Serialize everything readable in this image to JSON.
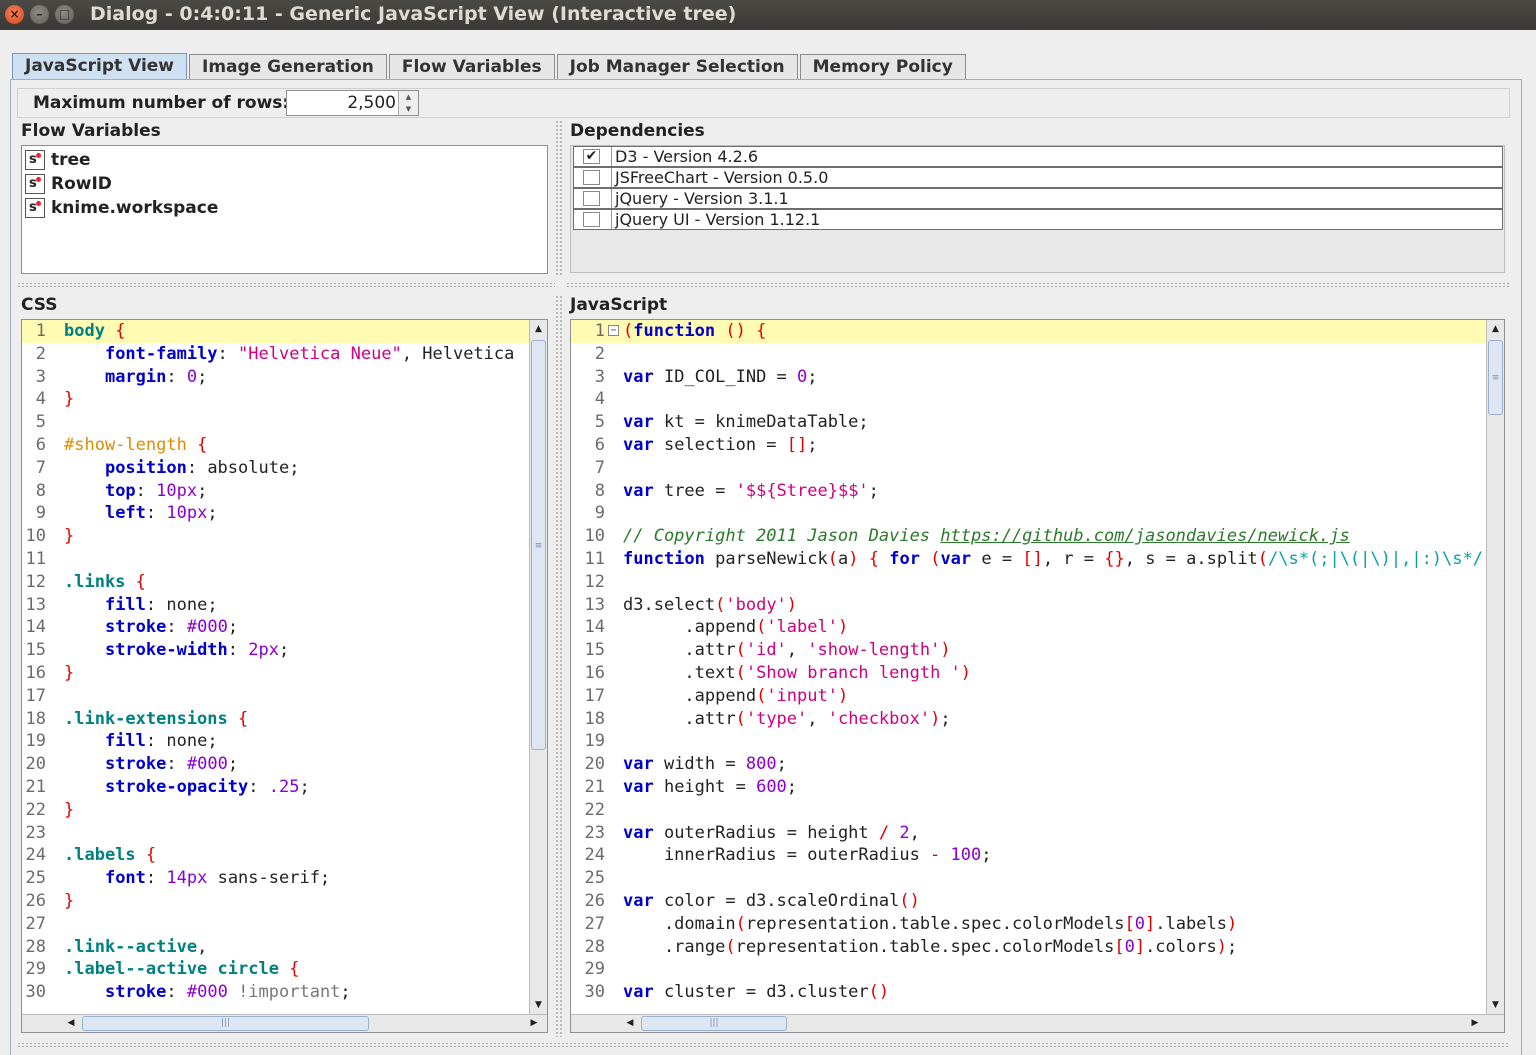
{
  "window": {
    "title": "Dialog - 0:4:0:11 - Generic JavaScript View (Interactive tree)"
  },
  "tabs": [
    "JavaScript View",
    "Image Generation",
    "Flow Variables",
    "Job Manager Selection",
    "Memory Policy"
  ],
  "options": {
    "max_rows_label": "Maximum number of rows:",
    "max_rows_value": "2,500"
  },
  "flow_variables": {
    "title": "Flow Variables",
    "items": [
      "tree",
      "RowID",
      "knime.workspace"
    ],
    "type_badge": "s"
  },
  "dependencies": {
    "title": "Dependencies",
    "items": [
      {
        "label": "D3 - Version 4.2.6",
        "checked": true
      },
      {
        "label": "JSFreeChart - Version 0.5.0",
        "checked": false
      },
      {
        "label": "jQuery - Version 3.1.1",
        "checked": false
      },
      {
        "label": "jQuery UI - Version 1.12.1",
        "checked": false
      }
    ]
  },
  "css_editor": {
    "title": "CSS",
    "lines": [
      [
        [
          "cls",
          "body"
        ],
        [
          "t",
          " "
        ],
        [
          "pn",
          "{"
        ]
      ],
      [
        [
          "t",
          "    "
        ],
        [
          "kw",
          "font-family"
        ],
        [
          "t",
          ": "
        ],
        [
          "str",
          "\"Helvetica Neue\""
        ],
        [
          "t",
          ", Helvetica"
        ]
      ],
      [
        [
          "t",
          "    "
        ],
        [
          "kw",
          "margin"
        ],
        [
          "t",
          ": "
        ],
        [
          "num",
          "0"
        ],
        [
          "t",
          ";"
        ]
      ],
      [
        [
          "pn",
          "}"
        ]
      ],
      [],
      [
        [
          "id",
          "#show-length"
        ],
        [
          "t",
          " "
        ],
        [
          "pn",
          "{"
        ]
      ],
      [
        [
          "t",
          "    "
        ],
        [
          "kw",
          "position"
        ],
        [
          "t",
          ": absolute;"
        ]
      ],
      [
        [
          "t",
          "    "
        ],
        [
          "kw",
          "top"
        ],
        [
          "t",
          ": "
        ],
        [
          "num",
          "10px"
        ],
        [
          "t",
          ";"
        ]
      ],
      [
        [
          "t",
          "    "
        ],
        [
          "kw",
          "left"
        ],
        [
          "t",
          ": "
        ],
        [
          "num",
          "10px"
        ],
        [
          "t",
          ";"
        ]
      ],
      [
        [
          "pn",
          "}"
        ]
      ],
      [],
      [
        [
          "cls",
          ".links"
        ],
        [
          "t",
          " "
        ],
        [
          "pn",
          "{"
        ]
      ],
      [
        [
          "t",
          "    "
        ],
        [
          "kw",
          "fill"
        ],
        [
          "t",
          ": none;"
        ]
      ],
      [
        [
          "t",
          "    "
        ],
        [
          "kw",
          "stroke"
        ],
        [
          "t",
          ": "
        ],
        [
          "num",
          "#000"
        ],
        [
          "t",
          ";"
        ]
      ],
      [
        [
          "t",
          "    "
        ],
        [
          "kw",
          "stroke-width"
        ],
        [
          "t",
          ": "
        ],
        [
          "num",
          "2px"
        ],
        [
          "t",
          ";"
        ]
      ],
      [
        [
          "pn",
          "}"
        ]
      ],
      [],
      [
        [
          "cls",
          ".link-extensions"
        ],
        [
          "t",
          " "
        ],
        [
          "pn",
          "{"
        ]
      ],
      [
        [
          "t",
          "    "
        ],
        [
          "kw",
          "fill"
        ],
        [
          "t",
          ": none;"
        ]
      ],
      [
        [
          "t",
          "    "
        ],
        [
          "kw",
          "stroke"
        ],
        [
          "t",
          ": "
        ],
        [
          "num",
          "#000"
        ],
        [
          "t",
          ";"
        ]
      ],
      [
        [
          "t",
          "    "
        ],
        [
          "kw",
          "stroke-opacity"
        ],
        [
          "t",
          ": "
        ],
        [
          "num",
          ".25"
        ],
        [
          "t",
          ";"
        ]
      ],
      [
        [
          "pn",
          "}"
        ]
      ],
      [],
      [
        [
          "cls",
          ".labels"
        ],
        [
          "t",
          " "
        ],
        [
          "pn",
          "{"
        ]
      ],
      [
        [
          "t",
          "    "
        ],
        [
          "kw",
          "font"
        ],
        [
          "t",
          ": "
        ],
        [
          "num",
          "14px"
        ],
        [
          "t",
          " sans-serif;"
        ]
      ],
      [
        [
          "pn",
          "}"
        ]
      ],
      [],
      [
        [
          "cls",
          ".link--active"
        ],
        [
          "t",
          ","
        ]
      ],
      [
        [
          "cls",
          ".label--active circle"
        ],
        [
          "t",
          " "
        ],
        [
          "pn",
          "{"
        ]
      ],
      [
        [
          "t",
          "    "
        ],
        [
          "kw",
          "stroke"
        ],
        [
          "t",
          ": "
        ],
        [
          "num",
          "#000"
        ],
        [
          "t",
          " "
        ],
        [
          "imp",
          "!important"
        ],
        [
          "t",
          ";"
        ]
      ]
    ]
  },
  "js_editor": {
    "title": "JavaScript",
    "lines": [
      [
        [
          "pn",
          "("
        ],
        [
          "kw",
          "function"
        ],
        [
          "t",
          " "
        ],
        [
          "pn",
          "()"
        ],
        [
          "t",
          " "
        ],
        [
          "pn",
          "{"
        ]
      ],
      [],
      [
        [
          "kw",
          "var"
        ],
        [
          "t",
          " ID_COL_IND = "
        ],
        [
          "num",
          "0"
        ],
        [
          "t",
          ";"
        ]
      ],
      [],
      [
        [
          "kw",
          "var"
        ],
        [
          "t",
          " kt = knimeDataTable;"
        ]
      ],
      [
        [
          "kw",
          "var"
        ],
        [
          "t",
          " selection = "
        ],
        [
          "pn",
          "[]"
        ],
        [
          "t",
          ";"
        ]
      ],
      [],
      [
        [
          "kw",
          "var"
        ],
        [
          "t",
          " tree = "
        ],
        [
          "str",
          "'$${Stree}$$'"
        ],
        [
          "t",
          ";"
        ]
      ],
      [],
      [
        [
          "cm",
          "// Copyright 2011 Jason Davies "
        ],
        [
          "url",
          "https://github.com/jasondavies/newick.js"
        ]
      ],
      [
        [
          "kw",
          "function"
        ],
        [
          "t",
          " parseNewick"
        ],
        [
          "pn",
          "("
        ],
        [
          "t",
          "a"
        ],
        [
          "pn",
          ")"
        ],
        [
          "t",
          " "
        ],
        [
          "pn",
          "{"
        ],
        [
          "t",
          " "
        ],
        [
          "kw",
          "for"
        ],
        [
          "t",
          " "
        ],
        [
          "pn",
          "("
        ],
        [
          "kw",
          "var"
        ],
        [
          "t",
          " e = "
        ],
        [
          "pn",
          "[]"
        ],
        [
          "t",
          ", r = "
        ],
        [
          "pn",
          "{}"
        ],
        [
          "t",
          ", s = a.split"
        ],
        [
          "pn",
          "("
        ],
        [
          "re",
          "/\\s*(;|\\(|\\)|,|:)\\s*/"
        ]
      ],
      [],
      [
        [
          "t",
          "d3.select"
        ],
        [
          "pn",
          "("
        ],
        [
          "str",
          "'body'"
        ],
        [
          "pn",
          ")"
        ]
      ],
      [
        [
          "t",
          "      .append"
        ],
        [
          "pn",
          "("
        ],
        [
          "str",
          "'label'"
        ],
        [
          "pn",
          ")"
        ]
      ],
      [
        [
          "t",
          "      .attr"
        ],
        [
          "pn",
          "("
        ],
        [
          "str",
          "'id'"
        ],
        [
          "t",
          ", "
        ],
        [
          "str",
          "'show-length'"
        ],
        [
          "pn",
          ")"
        ]
      ],
      [
        [
          "t",
          "      .text"
        ],
        [
          "pn",
          "("
        ],
        [
          "str",
          "'Show branch length '"
        ],
        [
          "pn",
          ")"
        ]
      ],
      [
        [
          "t",
          "      .append"
        ],
        [
          "pn",
          "("
        ],
        [
          "str",
          "'input'"
        ],
        [
          "pn",
          ")"
        ]
      ],
      [
        [
          "t",
          "      .attr"
        ],
        [
          "pn",
          "("
        ],
        [
          "str",
          "'type'"
        ],
        [
          "t",
          ", "
        ],
        [
          "str",
          "'checkbox'"
        ],
        [
          "pn",
          ")"
        ],
        [
          "t",
          ";"
        ]
      ],
      [],
      [
        [
          "kw",
          "var"
        ],
        [
          "t",
          " width = "
        ],
        [
          "num",
          "800"
        ],
        [
          "t",
          ";"
        ]
      ],
      [
        [
          "kw",
          "var"
        ],
        [
          "t",
          " height = "
        ],
        [
          "num",
          "600"
        ],
        [
          "t",
          ";"
        ]
      ],
      [],
      [
        [
          "kw",
          "var"
        ],
        [
          "t",
          " outerRadius = height "
        ],
        [
          "pn",
          "/"
        ],
        [
          "t",
          " "
        ],
        [
          "num",
          "2"
        ],
        [
          "t",
          ","
        ]
      ],
      [
        [
          "t",
          "    innerRadius = outerRadius "
        ],
        [
          "pn",
          "-"
        ],
        [
          "t",
          " "
        ],
        [
          "num",
          "100"
        ],
        [
          "t",
          ";"
        ]
      ],
      [],
      [
        [
          "kw",
          "var"
        ],
        [
          "t",
          " color = d3.scaleOrdinal"
        ],
        [
          "pn",
          "()"
        ]
      ],
      [
        [
          "t",
          "    .domain"
        ],
        [
          "pn",
          "("
        ],
        [
          "t",
          "representation.table.spec.colorModels"
        ],
        [
          "pn",
          "["
        ],
        [
          "num",
          "0"
        ],
        [
          "pn",
          "]"
        ],
        [
          "t",
          ".labels"
        ],
        [
          "pn",
          ")"
        ]
      ],
      [
        [
          "t",
          "    .range"
        ],
        [
          "pn",
          "("
        ],
        [
          "t",
          "representation.table.spec.colorModels"
        ],
        [
          "pn",
          "["
        ],
        [
          "num",
          "0"
        ],
        [
          "pn",
          "]"
        ],
        [
          "t",
          ".colors"
        ],
        [
          "pn",
          ")"
        ],
        [
          "t",
          ";"
        ]
      ],
      [],
      [
        [
          "kw",
          "var"
        ],
        [
          "t",
          " cluster = d3.cluster"
        ],
        [
          "pn",
          "()"
        ]
      ]
    ]
  },
  "colors": {
    "keyword": "#0000cc",
    "selector": "#008080",
    "id_selector": "#e08b00",
    "string": "#d00080",
    "number": "#8a00d4",
    "punctuation": "#e00000",
    "comment": "#2a7a2a",
    "current_line": "#fffbb2",
    "active_tab": "#cfe0f2"
  }
}
